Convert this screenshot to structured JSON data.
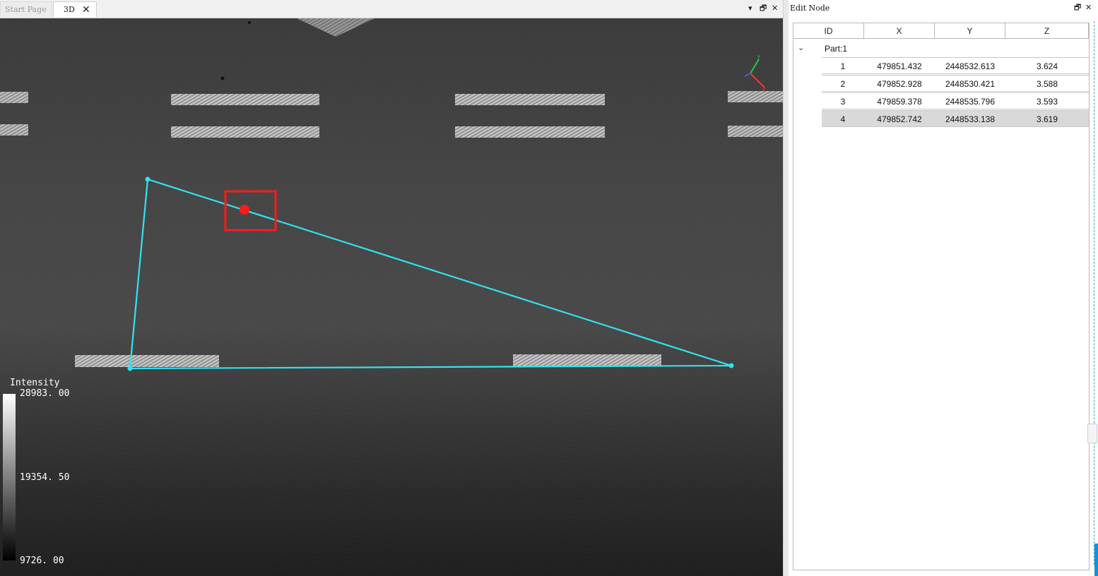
{
  "tabs": [
    {
      "label": "Start Page",
      "active": false
    },
    {
      "label": "3D",
      "active": true
    }
  ],
  "window_controls": {
    "menu": "▾",
    "restore": "🗗",
    "close": "✕"
  },
  "viewer": {
    "legend": {
      "title": "Intensity",
      "max": "28983. 00",
      "mid": "19354. 50",
      "min": "9726. 00"
    },
    "polyline_color": "#2fe3f0",
    "marker_color": "#ff1a1a"
  },
  "panel": {
    "title": "Edit Node",
    "controls": {
      "restore": "🗗",
      "close": "✕"
    },
    "columns": [
      "ID",
      "X",
      "Y",
      "Z"
    ],
    "group": {
      "toggle": "⌄",
      "label": "Part:1"
    },
    "rows": [
      {
        "id": "1",
        "x": "479851.432",
        "y": "2448532.613",
        "z": "3.624"
      },
      {
        "id": "2",
        "x": "479852.928",
        "y": "2448530.421",
        "z": "3.588"
      },
      {
        "id": "3",
        "x": "479859.378",
        "y": "2448535.796",
        "z": "3.593"
      },
      {
        "id": "4",
        "x": "479852.742",
        "y": "2448533.138",
        "z": "3.619"
      }
    ],
    "selected_row": 4
  }
}
